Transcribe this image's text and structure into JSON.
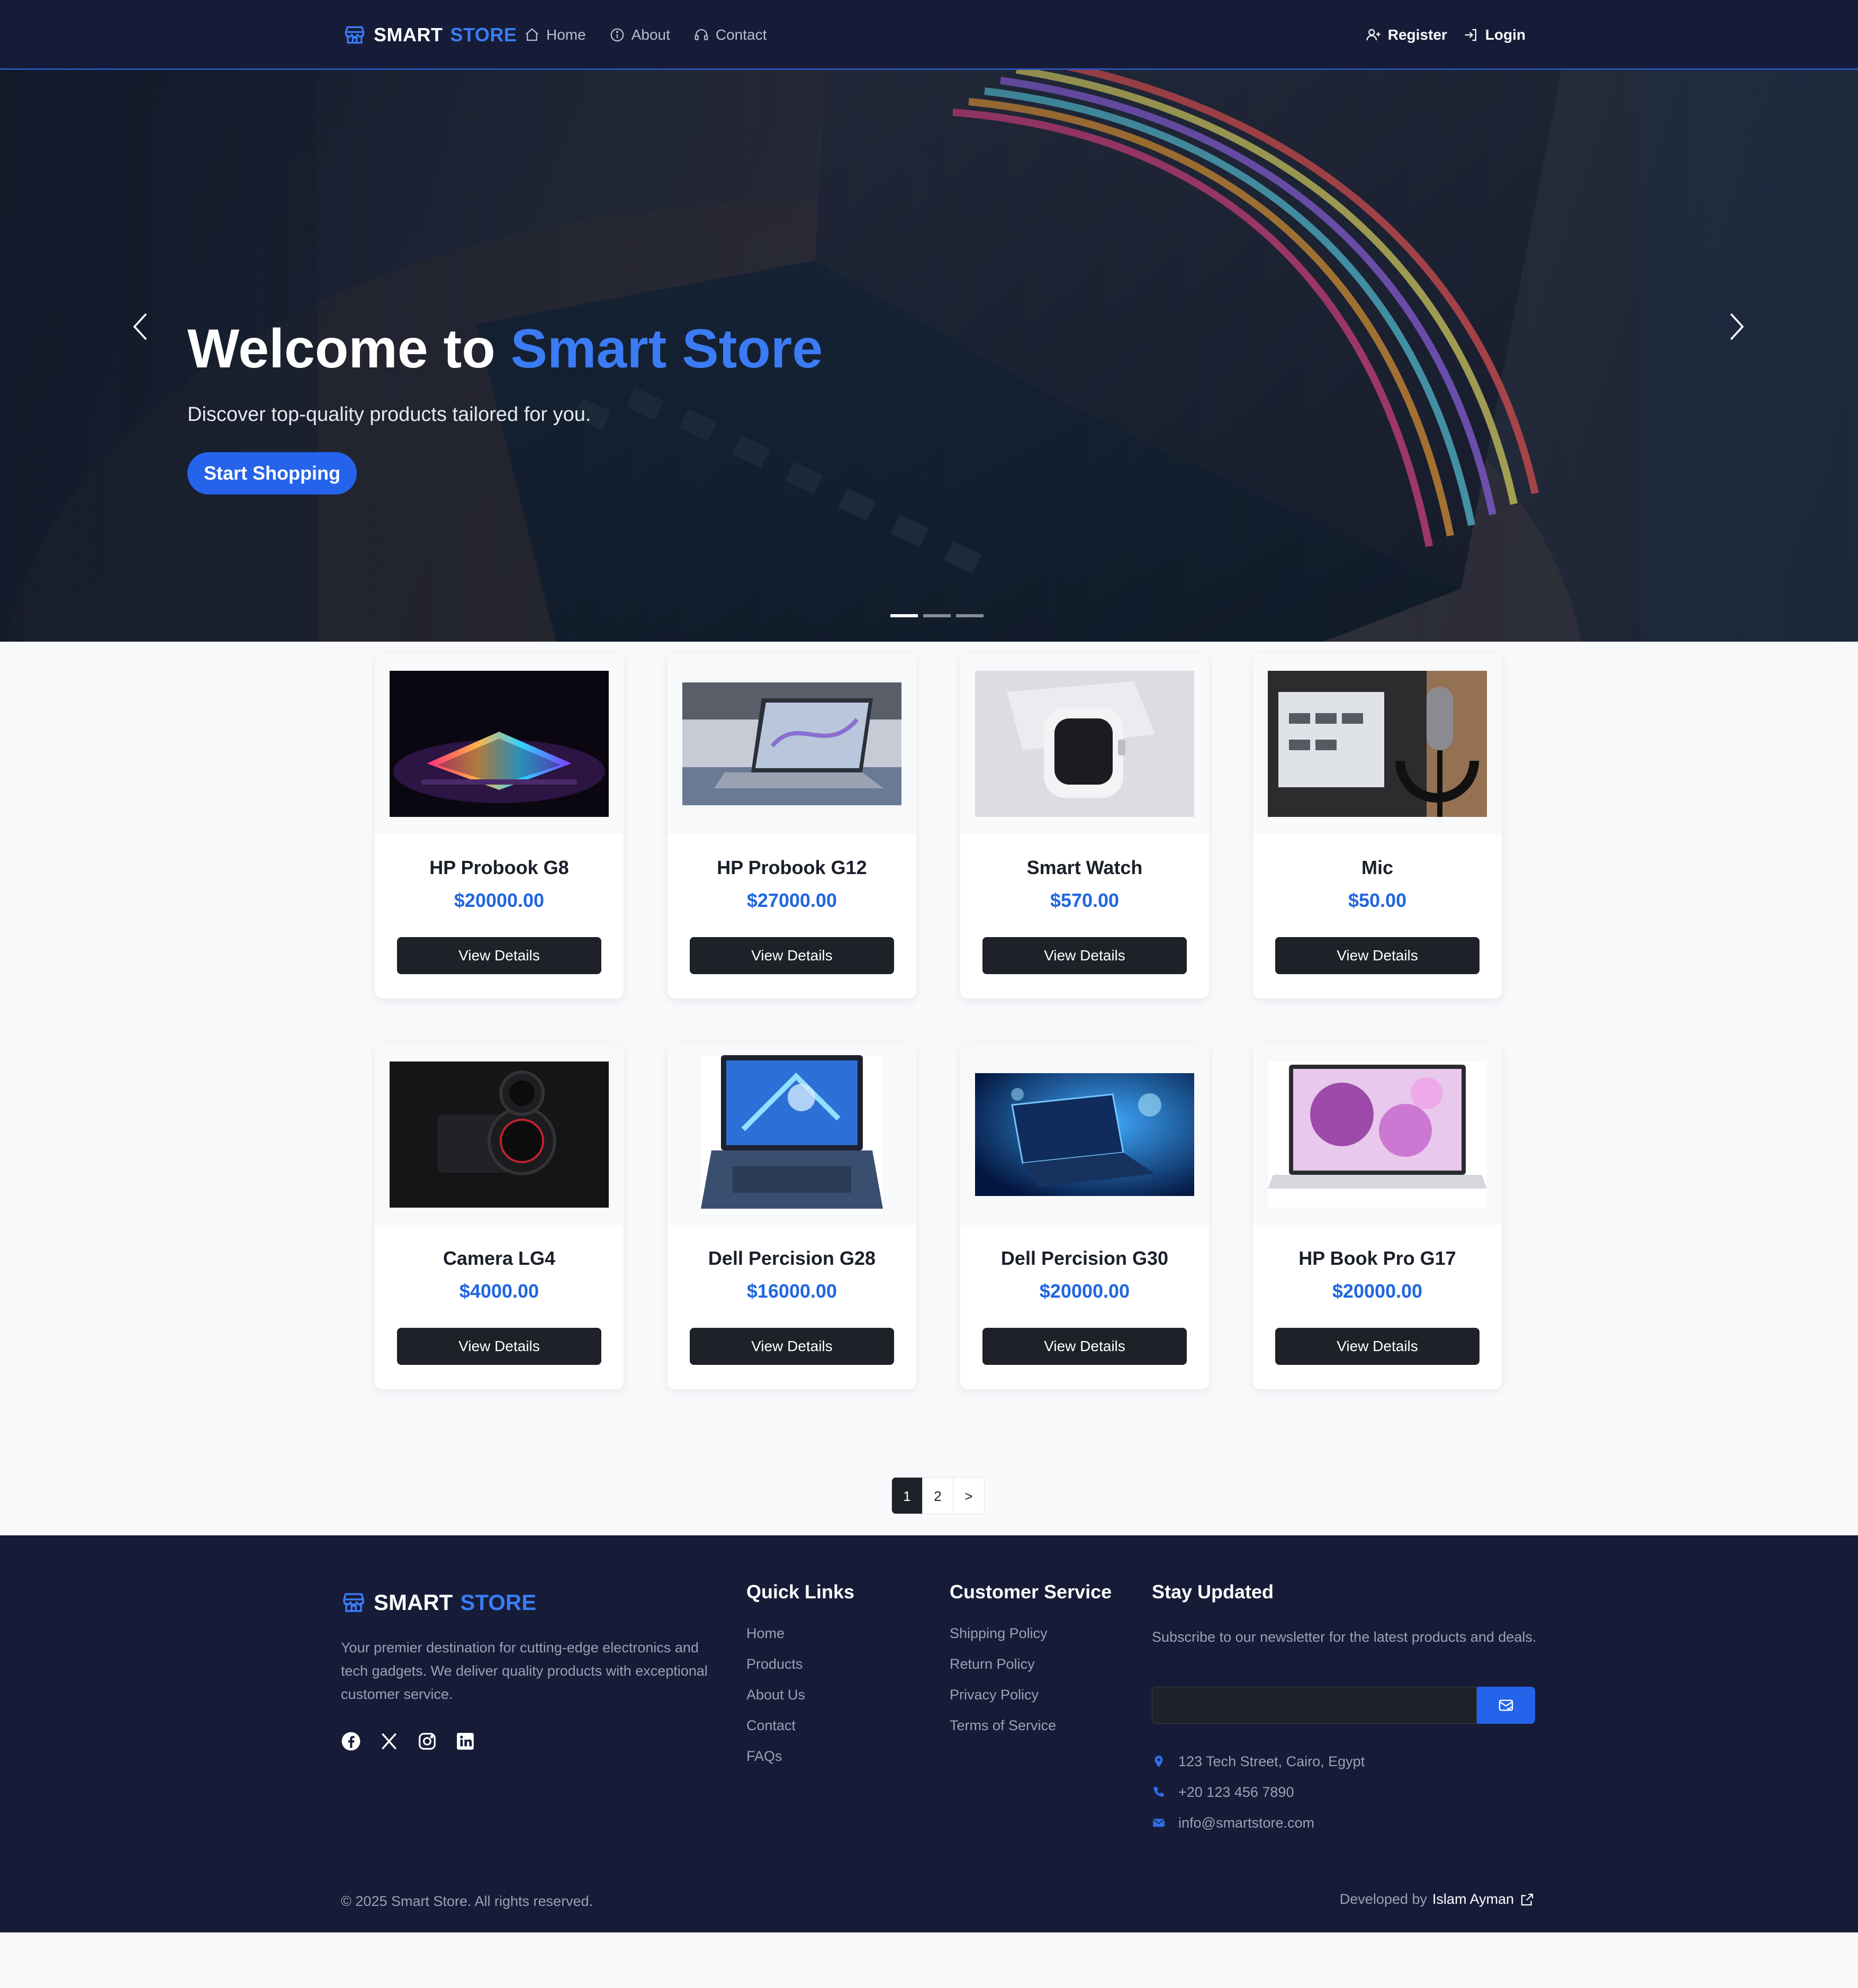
{
  "nav": {
    "brand_primary": "SMART",
    "brand_accent": "STORE",
    "links": [
      {
        "label": "Home",
        "icon": "home-icon"
      },
      {
        "label": "About",
        "icon": "info-icon"
      },
      {
        "label": "Contact",
        "icon": "headset-icon"
      }
    ],
    "register_label": "Register",
    "login_label": "Login"
  },
  "hero": {
    "title_prefix": "Welcome to",
    "title_accent": "Smart Store",
    "subtitle": "Discover top-quality products tailored for you.",
    "cta_label": "Start Shopping",
    "slides_count": 3,
    "active_slide": 1
  },
  "products": [
    {
      "name": "HP Probook G8",
      "price": "$20000.00",
      "button": "View Details"
    },
    {
      "name": "HP Probook G12",
      "price": "$27000.00",
      "button": "View Details"
    },
    {
      "name": "Smart Watch",
      "price": "$570.00",
      "button": "View Details"
    },
    {
      "name": "Mic",
      "price": "$50.00",
      "button": "View Details"
    },
    {
      "name": "Camera LG4",
      "price": "$4000.00",
      "button": "View Details"
    },
    {
      "name": "Dell Percision G28",
      "price": "$16000.00",
      "button": "View Details"
    },
    {
      "name": "Dell Percision G30",
      "price": "$20000.00",
      "button": "View Details"
    },
    {
      "name": "HP Book Pro G17",
      "price": "$20000.00",
      "button": "View Details"
    }
  ],
  "pagination": {
    "pages": [
      "1",
      "2"
    ],
    "next": ">",
    "current": "1"
  },
  "footer": {
    "brand_primary": "SMART",
    "brand_accent": "STORE",
    "about": "Your premier destination for cutting-edge electronics and tech gadgets. We deliver quality products with exceptional customer service.",
    "social": [
      "facebook-icon",
      "x-icon",
      "instagram-icon",
      "linkedin-icon"
    ],
    "quick_links": {
      "title": "Quick Links",
      "items": [
        "Home",
        "Products",
        "About Us",
        "Contact",
        "FAQs"
      ]
    },
    "customer_service": {
      "title": "Customer Service",
      "items": [
        "Shipping Policy",
        "Return Policy",
        "Privacy Policy",
        "Terms of Service"
      ]
    },
    "newsletter": {
      "title": "Stay Updated",
      "text": "Subscribe to our newsletter for the latest products and deals.",
      "input_value": ""
    },
    "contact": {
      "address": "123 Tech Street, Cairo, Egypt",
      "phone": "+20 123 456 7890",
      "email": "info@smartstore.com"
    },
    "copyright": "© 2025 Smart Store. All rights reserved.",
    "developed_by": "Developed by",
    "developer": "Islam Ayman"
  },
  "colors": {
    "navy": "#161c38",
    "accent_blue": "#3b7cf5",
    "button_blue": "#2563eb",
    "price_blue": "#1f66e0",
    "dark_button": "#1e2228"
  }
}
